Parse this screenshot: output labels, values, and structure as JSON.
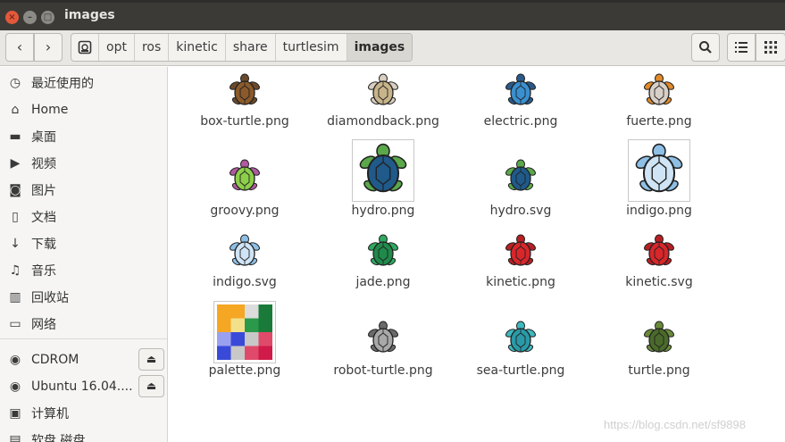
{
  "window": {
    "title": "images",
    "close_glyph": "×",
    "min_glyph": "–",
    "max_glyph": "□"
  },
  "toolbar": {
    "back_glyph": "‹",
    "forward_glyph": "›",
    "breadcrumbs": [
      "opt",
      "ros",
      "kinetic",
      "share",
      "turtlesim",
      "images"
    ],
    "root_icon": "disk-icon",
    "view_icons": [
      "search-icon",
      "list-view-icon",
      "grid-view-icon"
    ]
  },
  "sidebar": {
    "items": [
      {
        "label": "最近使用的",
        "icon": "recent-icon",
        "glyph": "◷"
      },
      {
        "label": "Home",
        "icon": "home-icon",
        "glyph": "⌂"
      },
      {
        "label": "桌面",
        "icon": "desktop-folder-icon",
        "glyph": "▬"
      },
      {
        "label": "视频",
        "icon": "video-icon",
        "glyph": "▶"
      },
      {
        "label": "图片",
        "icon": "camera-icon",
        "glyph": "◙"
      },
      {
        "label": "文档",
        "icon": "document-icon",
        "glyph": "▯"
      },
      {
        "label": "下载",
        "icon": "download-icon",
        "glyph": "↓"
      },
      {
        "label": "音乐",
        "icon": "music-icon",
        "glyph": "♫"
      },
      {
        "label": "回收站",
        "icon": "trash-icon",
        "glyph": "▥"
      },
      {
        "label": "网络",
        "icon": "network-icon",
        "glyph": "▭"
      },
      {
        "label": "CDROM",
        "icon": "optical-disc-icon",
        "glyph": "◉"
      },
      {
        "label": "Ubuntu 16.04....",
        "icon": "optical-disc-icon",
        "glyph": "◉"
      },
      {
        "label": "计算机",
        "icon": "computer-icon",
        "glyph": "▣"
      },
      {
        "label": "软盘 磁盘",
        "icon": "floppy-icon",
        "glyph": "▤"
      }
    ],
    "eject_glyph": "⏏"
  },
  "files": [
    {
      "name": "box-turtle.png",
      "icon": "box-turtle-icon",
      "shell": "#8b5a2b",
      "body": "#6b4a2b",
      "framed": false
    },
    {
      "name": "diamondback.png",
      "icon": "diamondback-turtle-icon",
      "shell": "#c8b48a",
      "body": "#d8cfc0",
      "framed": false
    },
    {
      "name": "electric.png",
      "icon": "electric-turtle-icon",
      "shell": "#3a8fd0",
      "body": "#2a5a8a",
      "framed": false
    },
    {
      "name": "fuerte.png",
      "icon": "fuerte-turtle-icon",
      "shell": "#d8d0c8",
      "body": "#e08a2a",
      "framed": false
    },
    {
      "name": "groovy.png",
      "icon": "groovy-turtle-icon",
      "shell": "#8ccf4a",
      "body": "#b05aa0",
      "framed": false
    },
    {
      "name": "hydro.png",
      "icon": "hydro-turtle-icon",
      "shell": "#1f5a8a",
      "body": "#5aa84a",
      "framed": true
    },
    {
      "name": "hydro.svg",
      "icon": "hydro-turtle-icon",
      "shell": "#1f5a8a",
      "body": "#5aa84a",
      "framed": false
    },
    {
      "name": "indigo.png",
      "icon": "indigo-turtle-icon",
      "shell": "#cfe4f5",
      "body": "#8ec0e6",
      "framed": true
    },
    {
      "name": "indigo.svg",
      "icon": "indigo-turtle-icon",
      "shell": "#cfe4f5",
      "body": "#8ec0e6",
      "framed": false
    },
    {
      "name": "jade.png",
      "icon": "jade-turtle-icon",
      "shell": "#1f8a4a",
      "body": "#2fa860",
      "framed": false
    },
    {
      "name": "kinetic.png",
      "icon": "kinetic-turtle-icon",
      "shell": "#d8262a",
      "body": "#b81f22",
      "framed": false
    },
    {
      "name": "kinetic.svg",
      "icon": "kinetic-turtle-icon",
      "shell": "#d8262a",
      "body": "#b81f22",
      "framed": false
    },
    {
      "name": "palette.png",
      "icon": "palette-image-icon",
      "shell": "",
      "body": "",
      "framed": true
    },
    {
      "name": "robot-turtle.png",
      "icon": "robot-turtle-icon",
      "shell": "#a8a8a8",
      "body": "#6a6a6a",
      "framed": false
    },
    {
      "name": "sea-turtle.png",
      "icon": "sea-turtle-icon",
      "shell": "#2a9aa8",
      "body": "#3fb8c0",
      "framed": false
    },
    {
      "name": "turtle.png",
      "icon": "turtle-icon",
      "shell": "#4a6a2a",
      "body": "#6a8a3a",
      "framed": false
    }
  ],
  "watermark": "https://blog.csdn.net/sf9898"
}
